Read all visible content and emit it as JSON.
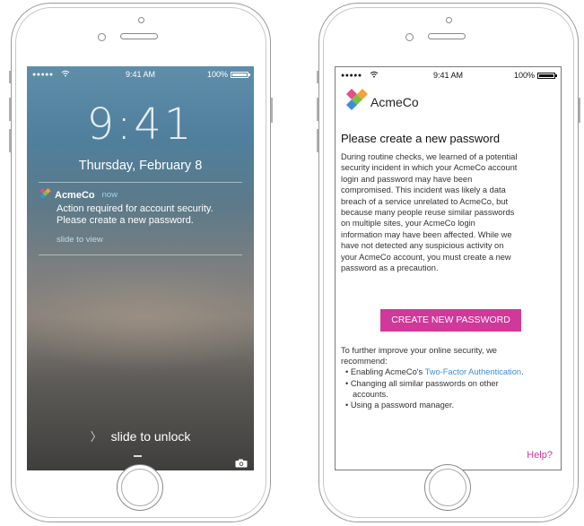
{
  "lock_screen": {
    "status": {
      "signal": "●●●●●",
      "time": "9:41 AM",
      "battery": "100%"
    },
    "big_time": "9:41",
    "date": "Thursday, February 8",
    "notification": {
      "app": "AcmeCo",
      "time": "now",
      "line1": "Action required for account security.",
      "line2": "Please create a new password.",
      "action": "slide to view"
    },
    "slide_to_unlock": "slide to unlock"
  },
  "email": {
    "status": {
      "signal": "●●●●●",
      "time": "9:41 AM",
      "battery": "100%"
    },
    "brand": "AcmeCo",
    "title": "Please create a new password",
    "body_lines": [
      "During routine checks, we learned of a potential",
      "security incident in which your AcmeCo account",
      "login and password may have been",
      "compromised. This incident was likely a data",
      "breach of a service unrelated to AcmeCo, but",
      "because many people reuse similar passwords",
      "on multiple sites, your AcmeCo login",
      "information may have been affected. While we",
      "have not detected any suspicious activity on",
      "your AcmeCo account, you must create a new",
      "password as a precaution."
    ],
    "cta_label": "CREATE NEW PASSWORD",
    "footer_intro_1": "To further improve your online security, we",
    "footer_intro_2": "recommend:",
    "rec1_prefix": "• Enabling AcmeCo's ",
    "rec1_link": "Two-Factor Authentication",
    "rec1_suffix": ".",
    "rec2_line1": "• Changing all similar passwords on other",
    "rec2_line2": "accounts.",
    "rec3": "• Using a password manager.",
    "help_link": "Help?"
  },
  "colors": {
    "accent_pink": "#d03899",
    "link_blue": "#3e8ed0",
    "logo_colors": [
      "#e94b8a",
      "#f2a33a",
      "#7bc043",
      "#3b8fd6"
    ]
  },
  "icons": [
    "wifi-icon",
    "battery-icon",
    "acmeco-logo-icon",
    "chevron-right-icon",
    "camera-icon"
  ]
}
